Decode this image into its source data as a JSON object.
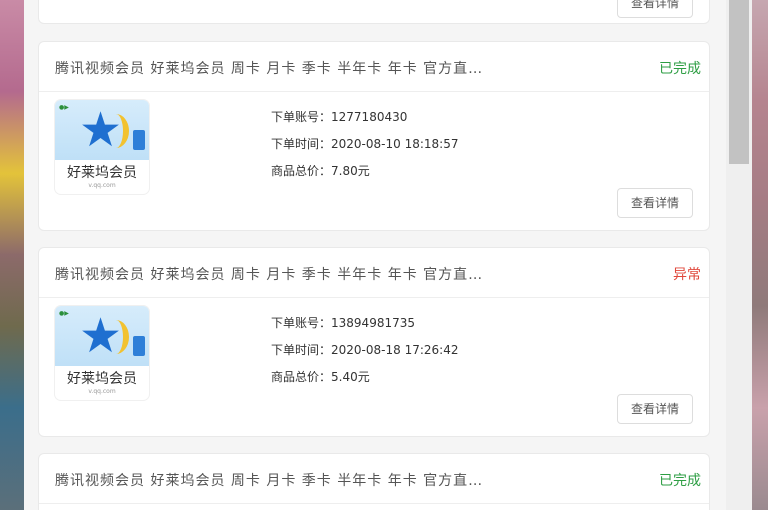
{
  "orders": [
    {
      "title": "",
      "status": "",
      "status_color": "#2e9e44",
      "detail_button": "查看详情"
    },
    {
      "title": "腾讯视频会员 好莱坞会员 周卡 月卡 季卡 半年卡 年卡 官方直…",
      "status": "已完成",
      "status_color": "#2e9e44",
      "product_image_text": "好莱坞会员",
      "order_number_label": "下单账号：",
      "order_number": "1277180430",
      "order_time_label": "下单时间：",
      "order_time": "2020-08-10 18:18:57",
      "price_label": "商品总价：",
      "price": "7.80元",
      "detail_button": "查看详情"
    },
    {
      "title": "腾讯视频会员 好莱坞会员 周卡 月卡 季卡 半年卡 年卡 官方直…",
      "status": "异常",
      "status_color": "#e0483c",
      "product_image_text": "好莱坞会员",
      "order_number_label": "下单账号：",
      "order_number": "13894981735",
      "order_time_label": "下单时间：",
      "order_time": "2020-08-18 17:26:42",
      "price_label": "商品总价：",
      "price": "5.40元",
      "detail_button": "查看详情"
    },
    {
      "title": "腾讯视频会员 好莱坞会员 周卡 月卡 季卡 半年卡 年卡 官方直…",
      "status": "已完成",
      "status_color": "#2e9e44"
    }
  ]
}
